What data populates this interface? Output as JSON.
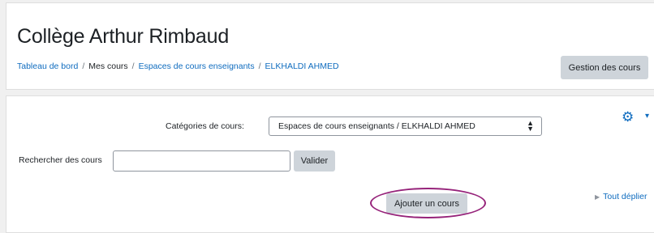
{
  "header": {
    "site_title": "Collège Arthur Rimbaud",
    "breadcrumb": {
      "items": [
        {
          "label": "Tableau de bord"
        },
        {
          "label": "Mes cours"
        },
        {
          "label": "Espaces de cours enseignants"
        },
        {
          "label": "ELKHALDI AHMED"
        }
      ],
      "separator": "/"
    },
    "manage_button": "Gestion des cours"
  },
  "main": {
    "settings_icon": "gear-icon",
    "category_label": "Catégories de cours:",
    "category_select_value": "Espaces de cours enseignants / ELKHALDI AHMED",
    "search_label": "Rechercher des cours",
    "search_value": "",
    "search_button": "Valider",
    "expand_all": "Tout déplier",
    "add_course_button": "Ajouter un cours"
  },
  "colors": {
    "link": "#0f6cbf",
    "button_bg": "#ced4da",
    "highlight_ellipse": "#96237a"
  }
}
